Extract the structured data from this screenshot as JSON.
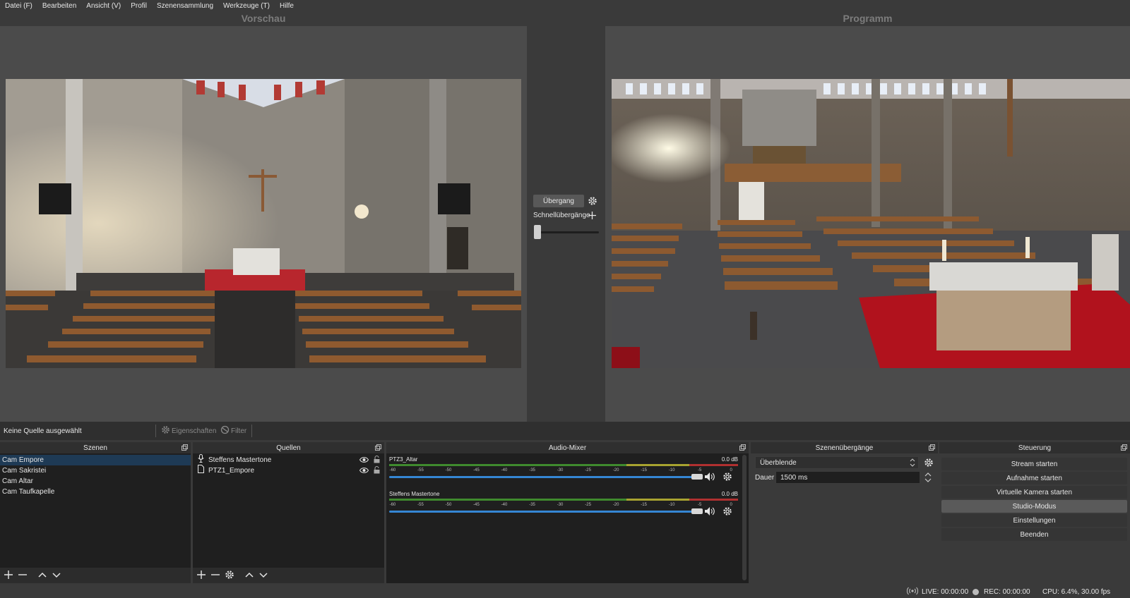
{
  "menu": [
    "Datei (F)",
    "Bearbeiten",
    "Ansicht (V)",
    "Profil",
    "Szenensammlung",
    "Werkzeuge (T)",
    "Hilfe"
  ],
  "preview": {
    "label": "Vorschau"
  },
  "program": {
    "label": "Programm"
  },
  "transition": {
    "button": "Übergang",
    "quick_label": "Schnellübergänge",
    "icons": [
      "gear-icon",
      "plus-icon"
    ]
  },
  "context": {
    "no_source": "Keine Quelle ausgewählt",
    "properties": "Eigenschaften",
    "filter": "Filter"
  },
  "scenes": {
    "title": "Szenen",
    "items": [
      {
        "label": "Cam Empore",
        "selected": true
      },
      {
        "label": "Cam Sakristei",
        "selected": false
      },
      {
        "label": "Cam Altar",
        "selected": false
      },
      {
        "label": "Cam Taufkapelle",
        "selected": false
      }
    ]
  },
  "sources": {
    "title": "Quellen",
    "items": [
      {
        "label": "Steffens Mastertone",
        "icon": "microphone-icon"
      },
      {
        "label": "PTZ1_Empore",
        "icon": "file-icon"
      }
    ]
  },
  "mixer": {
    "title": "Audio-Mixer",
    "ticks": [
      "-60",
      "-55",
      "-50",
      "-45",
      "-40",
      "-35",
      "-30",
      "-25",
      "-20",
      "-15",
      "-10",
      "-5",
      "0"
    ],
    "channels": [
      {
        "name": "PTZ3_Altar",
        "db": "0.0 dB",
        "volume": 1.0
      },
      {
        "name": "Steffens Mastertone",
        "db": "0.0 dB",
        "volume": 1.0
      }
    ]
  },
  "transitions_dock": {
    "title": "Szenenübergänge",
    "selected": "Überblende",
    "duration_label": "Dauer",
    "duration_value": "1500 ms"
  },
  "controls": {
    "title": "Steuerung",
    "buttons": [
      {
        "label": "Stream starten",
        "active": false
      },
      {
        "label": "Aufnahme starten",
        "active": false
      },
      {
        "label": "Virtuelle Kamera starten",
        "active": false
      },
      {
        "label": "Studio-Modus",
        "active": true
      },
      {
        "label": "Einstellungen",
        "active": false
      },
      {
        "label": "Beenden",
        "active": false
      }
    ]
  },
  "status": {
    "live": "LIVE: 00:00:00",
    "rec": "REC: 00:00:00",
    "cpu": "CPU: 6.4%, 30.00 fps"
  },
  "colors": {
    "accent": "#3586d4",
    "selection": "#1e3a55",
    "meter_green": "#3f8a2e",
    "meter_yellow": "#a8a330",
    "meter_red": "#b03030"
  }
}
